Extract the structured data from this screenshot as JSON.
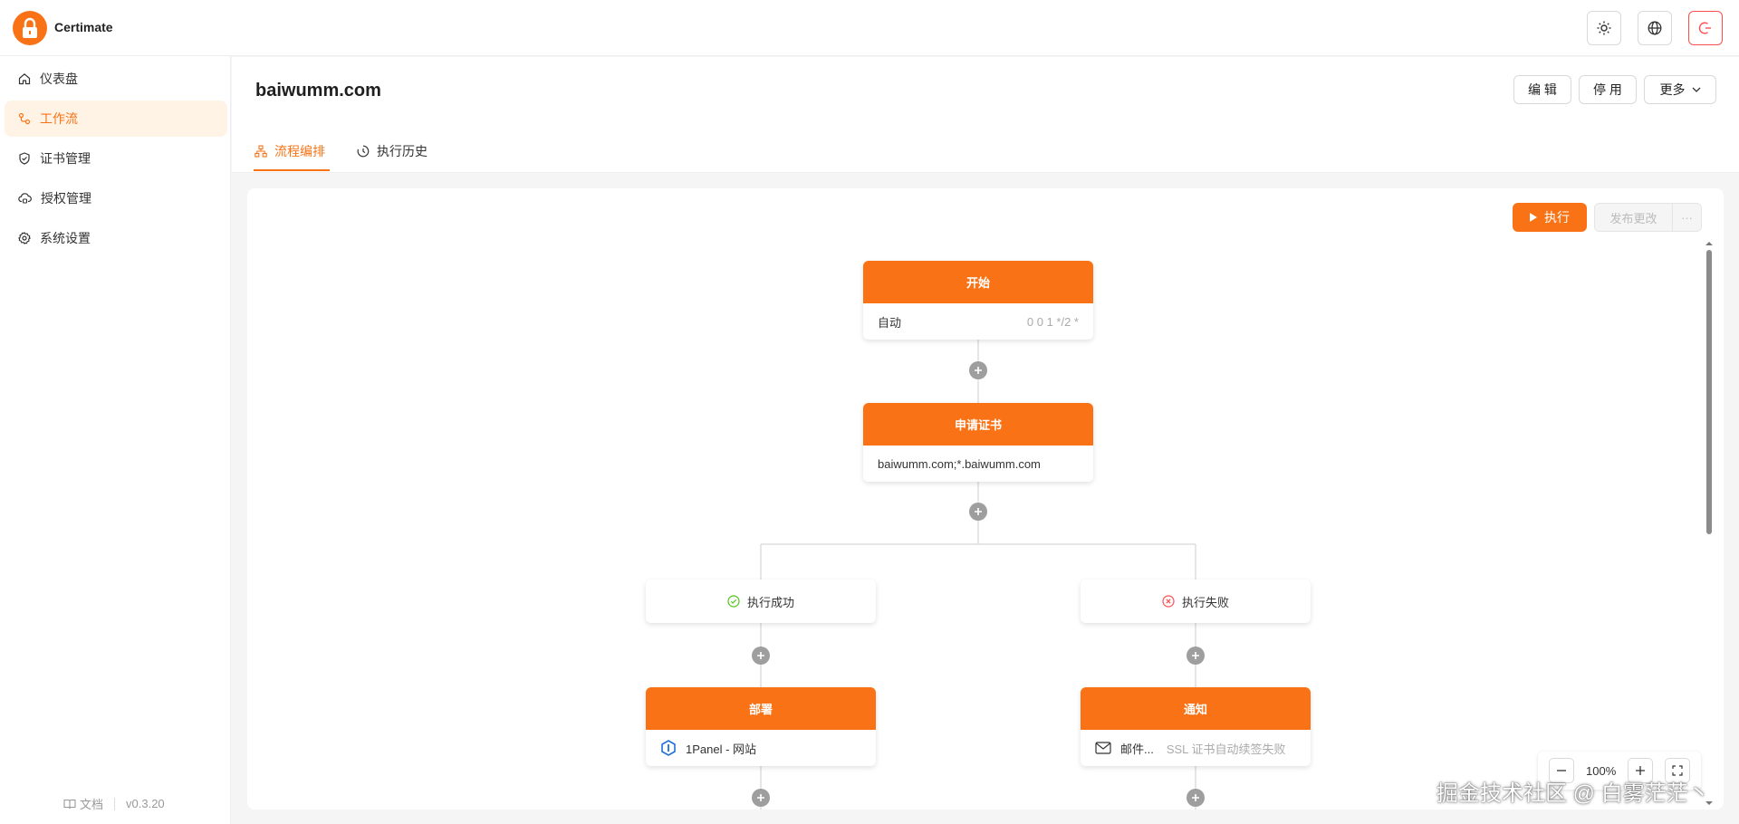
{
  "app": {
    "brand": "Certimate"
  },
  "sidebar": {
    "items": [
      {
        "label": "仪表盘",
        "icon": "home-icon",
        "active": false
      },
      {
        "label": "工作流",
        "icon": "workflow-icon",
        "active": true
      },
      {
        "label": "证书管理",
        "icon": "shield-check-icon",
        "active": false
      },
      {
        "label": "授权管理",
        "icon": "cloud-lock-icon",
        "active": false
      },
      {
        "label": "系统设置",
        "icon": "gear-icon",
        "active": false
      }
    ],
    "docs_label": "文档",
    "version": "v0.3.20"
  },
  "header": {
    "title": "baiwumm.com",
    "edit_label": "编 辑",
    "disable_label": "停 用",
    "more_label": "更多",
    "tabs": [
      {
        "label": "流程编排",
        "active": true
      },
      {
        "label": "执行历史",
        "active": false
      }
    ]
  },
  "canvas": {
    "run_label": "执行",
    "publish_label": "发布更改",
    "more_label": "···",
    "zoom": "100%"
  },
  "flow": {
    "start": {
      "title": "开始",
      "mode": "自动",
      "cron": "0 0 1 */2 *"
    },
    "apply": {
      "title": "申请证书",
      "domains": "baiwumm.com;*.baiwumm.com"
    },
    "success": {
      "label": "执行成功"
    },
    "failure": {
      "label": "执行失败"
    },
    "deploy": {
      "title": "部署",
      "provider": "1Panel - 网站"
    },
    "notify": {
      "title": "通知",
      "channel": "邮件...",
      "subject": "SSL 证书自动续签失败"
    }
  },
  "watermark": "掘金技术社区 @ 白雾茫茫丶",
  "colors": {
    "accent": "#f97316",
    "success": "#52c41a",
    "danger": "#ff4d4f"
  }
}
